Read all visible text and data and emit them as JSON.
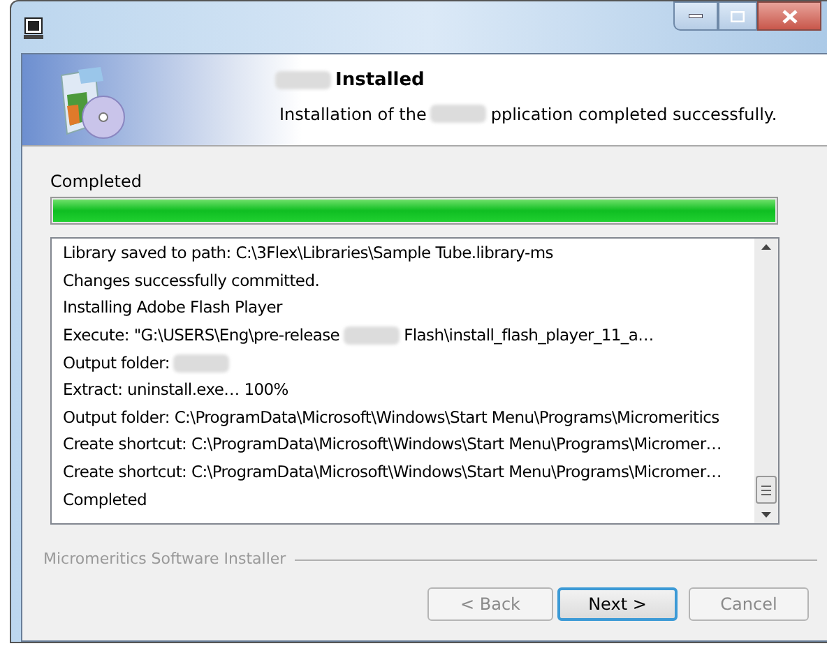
{
  "header": {
    "title": [
      {
        "kind": "blur"
      },
      {
        "kind": "text",
        "text": "Installed"
      }
    ],
    "subtitle": [
      {
        "kind": "text",
        "text": "Installation of the"
      },
      {
        "kind": "blur"
      },
      {
        "kind": "text",
        "text": "pplication completed successfully."
      }
    ]
  },
  "status": "Completed",
  "progress": {
    "level": 1
  },
  "log": [
    [
      {
        "kind": "text",
        "text": "Library saved to path: C:\\3Flex\\Libraries\\Sample Tube.library-ms"
      }
    ],
    [
      {
        "kind": "text",
        "text": "Changes successfully committed."
      }
    ],
    [
      {
        "kind": "text",
        "text": "Installing Adobe Flash Player"
      }
    ],
    [
      {
        "kind": "text",
        "text": "Execute: \"G:\\USERS\\Eng\\pre-release"
      },
      {
        "kind": "blur"
      },
      {
        "kind": "text",
        "text": "Flash\\install_flash_player_11_a…"
      }
    ],
    [
      {
        "kind": "text",
        "text": "Output folder:"
      },
      {
        "kind": "blur"
      }
    ],
    [
      {
        "kind": "text",
        "text": "Extract: uninstall.exe… 100%"
      }
    ],
    [
      {
        "kind": "text",
        "text": "Output folder: C:\\ProgramData\\Microsoft\\Windows\\Start Menu\\Programs\\Micromeritics"
      }
    ],
    [
      {
        "kind": "text",
        "text": "Create shortcut: C:\\ProgramData\\Microsoft\\Windows\\Start Menu\\Programs\\Micromer…"
      }
    ],
    [
      {
        "kind": "text",
        "text": "Create shortcut: C:\\ProgramData\\Microsoft\\Windows\\Start Menu\\Programs\\Micromer…"
      }
    ],
    [
      {
        "kind": "text",
        "text": "Completed"
      }
    ]
  ],
  "footer_label": "Micromeritics Software Installer",
  "buttons": [
    {
      "label": "< Back",
      "disabled": true,
      "default": false
    },
    {
      "label": "Next >",
      "disabled": false,
      "default": true
    },
    {
      "label": "Cancel",
      "disabled": true,
      "default": false
    }
  ]
}
